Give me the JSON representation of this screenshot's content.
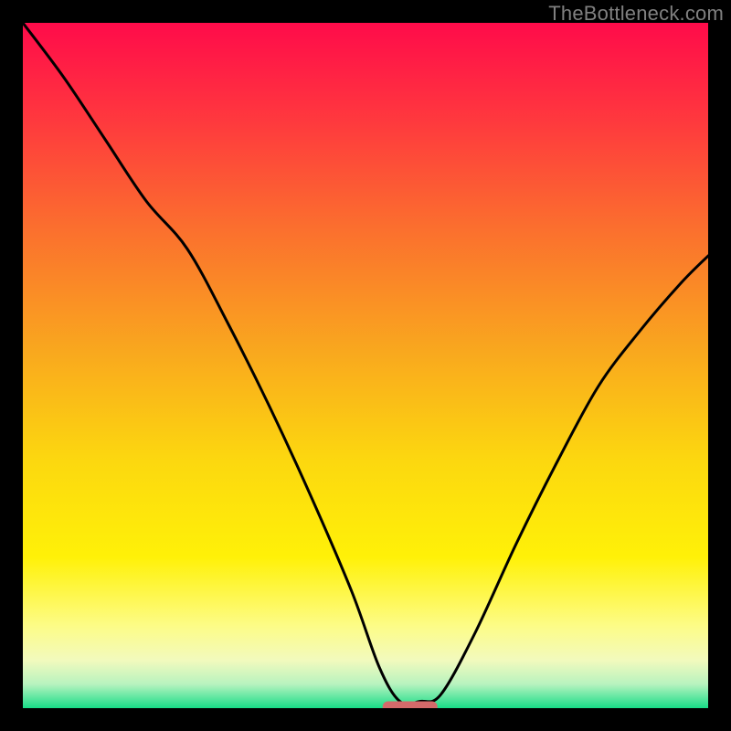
{
  "watermark": "TheBottleneck.com",
  "chart_data": {
    "type": "line",
    "title": "",
    "xlabel": "",
    "ylabel": "",
    "xlim": [
      0,
      100
    ],
    "ylim": [
      0,
      100
    ],
    "grid": false,
    "legend": false,
    "series": [
      {
        "name": "bottleneck-curve",
        "x": [
          0,
          6,
          12,
          18,
          24,
          30,
          36,
          42,
          48,
          52,
          55,
          58,
          61,
          66,
          72,
          78,
          84,
          90,
          96,
          100
        ],
        "values": [
          100,
          92,
          83,
          74,
          67,
          56,
          44,
          31,
          17,
          6,
          1,
          1,
          2,
          11,
          24,
          36,
          47,
          55,
          62,
          66
        ]
      }
    ],
    "marker": {
      "name": "optimal-marker",
      "x_center": 56.5,
      "half_width": 4,
      "y": 0.2,
      "color": "#d46a6a"
    },
    "background_gradient": {
      "stops": [
        {
          "offset": 0.0,
          "color": "#ff0b4a"
        },
        {
          "offset": 0.12,
          "color": "#ff3140"
        },
        {
          "offset": 0.3,
          "color": "#fb6f2e"
        },
        {
          "offset": 0.48,
          "color": "#f9a81e"
        },
        {
          "offset": 0.64,
          "color": "#fcd80f"
        },
        {
          "offset": 0.78,
          "color": "#fff108"
        },
        {
          "offset": 0.88,
          "color": "#fdfc87"
        },
        {
          "offset": 0.93,
          "color": "#f2fabd"
        },
        {
          "offset": 0.965,
          "color": "#b8f3bf"
        },
        {
          "offset": 0.985,
          "color": "#5ce6a0"
        },
        {
          "offset": 1.0,
          "color": "#18dd87"
        }
      ]
    }
  }
}
